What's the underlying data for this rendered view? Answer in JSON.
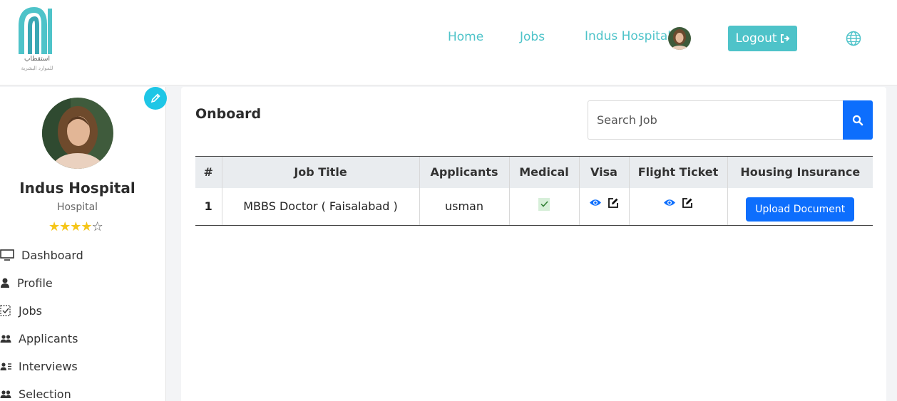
{
  "header": {
    "logo_text_ar": "استقطاب",
    "logo_subtext_ar": "للموارد البشرية",
    "nav": {
      "home": "Home",
      "jobs": "Jobs",
      "user": "Indus Hospital"
    },
    "logout_label": "Logout",
    "icons": {
      "logout": "logout-icon",
      "language": "globe-icon"
    }
  },
  "sidebar": {
    "name": "Indus Hospital",
    "role": "Hospital",
    "rating": 4,
    "rating_max": 5,
    "menu": [
      {
        "label": "Dashboard",
        "icon": "monitor-icon"
      },
      {
        "label": "Profile",
        "icon": "user-icon"
      },
      {
        "label": "Jobs",
        "icon": "clipboard-check-icon"
      },
      {
        "label": "Applicants",
        "icon": "users-icon"
      },
      {
        "label": "Interviews",
        "icon": "user-list-icon"
      },
      {
        "label": "Selection",
        "icon": "users-icon"
      }
    ]
  },
  "main": {
    "title": "Onboard",
    "search": {
      "placeholder": "Search Job"
    },
    "table": {
      "columns": [
        "#",
        "Job Title",
        "Applicants",
        "Medical",
        "Visa",
        "Flight Ticket",
        "Housing Insurance"
      ],
      "rows": [
        {
          "index": "1",
          "job_title": "MBBS Doctor ( Faisalabad )",
          "applicant": "usman",
          "medical_checked": true,
          "housing_action": "Upload Document"
        }
      ]
    }
  },
  "colors": {
    "accent": "#4ec3c9",
    "primary": "#0d6efd",
    "edit": "#1ec6e6",
    "star": "#f5c518"
  }
}
